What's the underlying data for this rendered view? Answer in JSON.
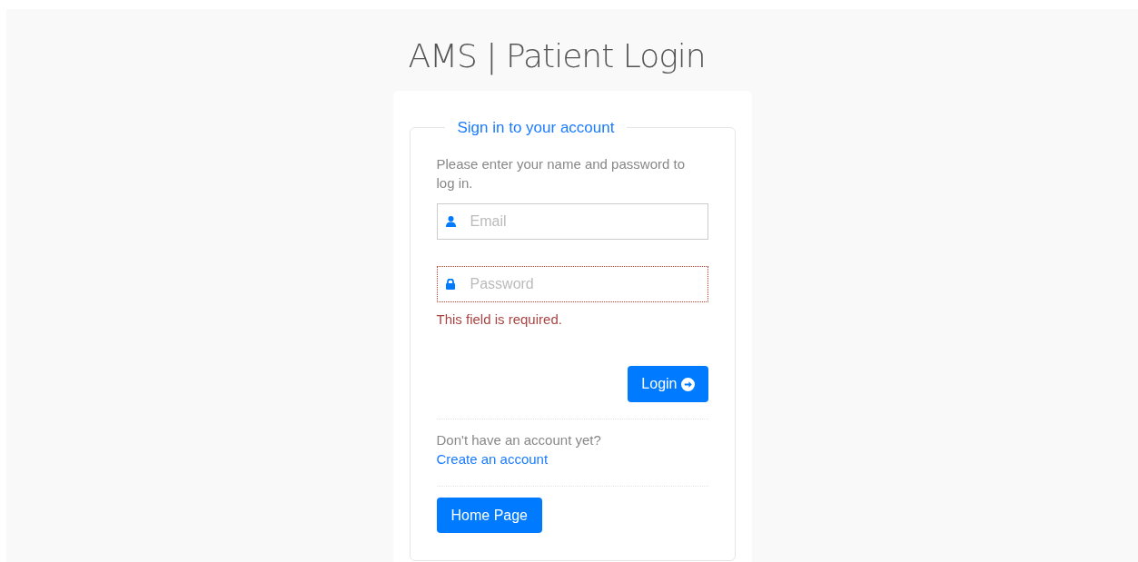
{
  "title": "AMS | Patient Login",
  "form": {
    "legend": "Sign in to your account",
    "intro": "Please enter your name and password to log in.",
    "fields": [
      {
        "kind": "email",
        "placeholder": "Email",
        "invalid": false
      },
      {
        "kind": "password",
        "placeholder": "Password",
        "invalid": true,
        "error": "This field is required."
      }
    ],
    "login_button": "Login",
    "signup_prompt": "Don't have an account yet?",
    "signup_link": "Create an account",
    "home_button": "Home Page"
  }
}
